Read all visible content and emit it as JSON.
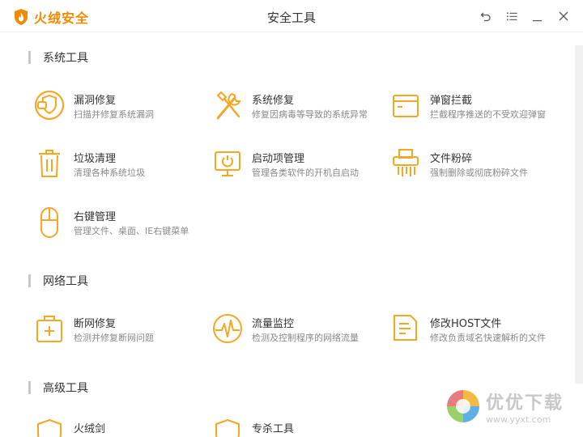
{
  "app": {
    "brand": "火绒安全",
    "window_title": "安全工具"
  },
  "colors": {
    "accent": "#f08a00",
    "icon_orange": "#f5a623",
    "section_bar": "#c7c7c7"
  },
  "sections": [
    {
      "title": "系统工具",
      "tools": [
        {
          "name": "漏洞修复",
          "desc": "扫描并修复系统漏洞",
          "icon": "shield-bandage-icon"
        },
        {
          "name": "系统修复",
          "desc": "修复因病毒等导致的系统异常",
          "icon": "wrench-screwdriver-icon"
        },
        {
          "name": "弹窗拦截",
          "desc": "拦截程序推送的不受欢迎弹窗",
          "icon": "popup-window-icon"
        },
        {
          "name": "垃圾清理",
          "desc": "清理各种系统垃圾",
          "icon": "trash-can-icon"
        },
        {
          "name": "启动项管理",
          "desc": "管理各类软件的开机自启动",
          "icon": "monitor-power-icon"
        },
        {
          "name": "文件粉碎",
          "desc": "强制删除或彻底粉碎文件",
          "icon": "shredder-icon"
        },
        {
          "name": "右键管理",
          "desc": "管理文件、桌面、IE右键菜单",
          "icon": "mouse-icon"
        }
      ]
    },
    {
      "title": "网络工具",
      "tools": [
        {
          "name": "断网修复",
          "desc": "检测并修复断网问题",
          "icon": "first-aid-kit-icon"
        },
        {
          "name": "流量监控",
          "desc": "检测及控制程序的网络流量",
          "icon": "pulse-monitor-icon"
        },
        {
          "name": "修改HOST文件",
          "desc": "修改负责域名快速解析的文件",
          "icon": "document-edit-icon"
        }
      ]
    },
    {
      "title": "高级工具",
      "tools": [
        {
          "name": "火绒剑",
          "desc": "",
          "icon": "shield-icon"
        },
        {
          "name": "专杀工具",
          "desc": "",
          "icon": "shield-icon"
        }
      ]
    }
  ],
  "watermark": {
    "title": "优优下载",
    "url": "www.yyxt.com"
  }
}
